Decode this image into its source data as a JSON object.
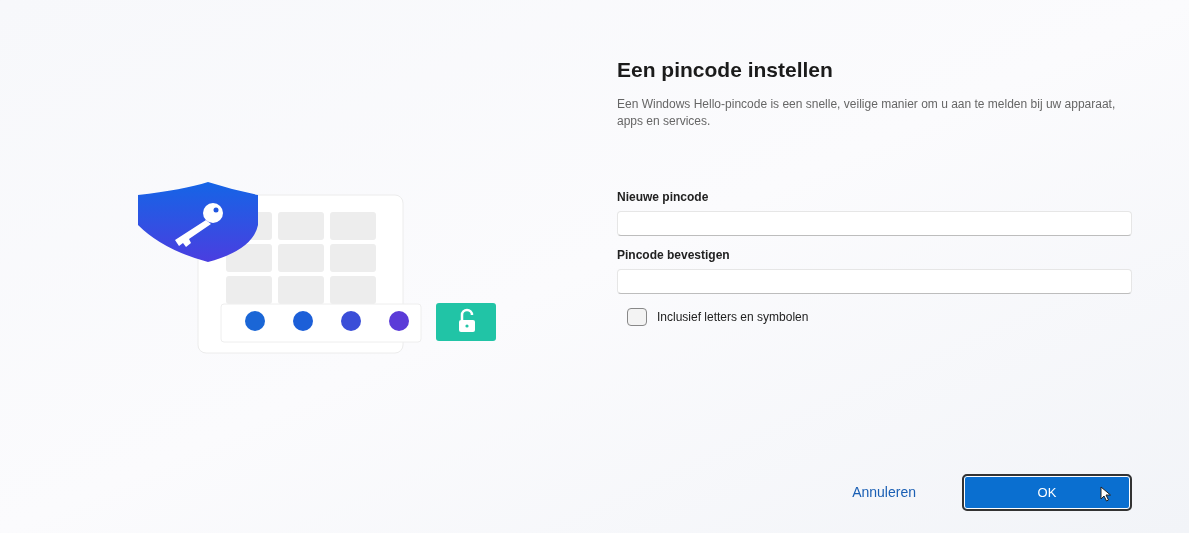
{
  "title": "Een pincode instellen",
  "description": "Een Windows Hello-pincode is een snelle, veilige manier om u aan te melden bij uw apparaat, apps en services.",
  "fields": [
    {
      "label": "Nieuwe pincode"
    },
    {
      "label": "Pincode bevestigen"
    }
  ],
  "checkbox": {
    "label": "Inclusief letters en symbolen",
    "checked": false
  },
  "buttons": [
    {
      "label": "Annuleren",
      "kind": "link"
    },
    {
      "label": "OK",
      "kind": "primary"
    }
  ]
}
